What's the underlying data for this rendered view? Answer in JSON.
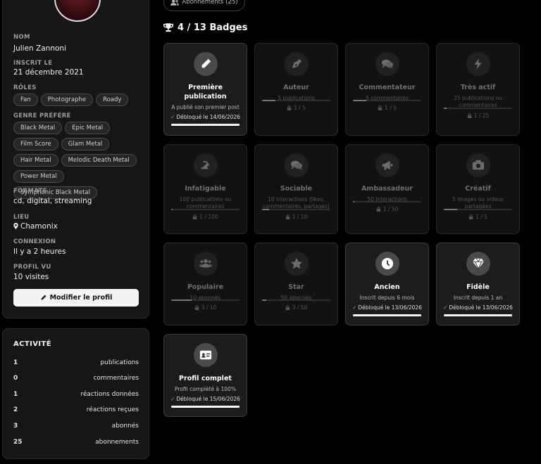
{
  "profile": {
    "name_label": "NOM",
    "name": "Julien Zannoni",
    "joined_label": "INSCRIT LE",
    "joined": "21 décembre 2021",
    "roles_label": "RÔLES",
    "roles": [
      "Fan",
      "Photographe",
      "Roady"
    ],
    "genres_label": "GENRE PRÉFÉRÉ",
    "genres": [
      "Black Metal",
      "Epic Metal",
      "Film Score",
      "Glam Metal",
      "Hair Metal",
      "Melodic Death Metal",
      "Power Metal",
      "Symphonic Black Metal"
    ],
    "formats_label": "FORMATS",
    "formats": "cd, digital, streaming",
    "location_label": "LIEU",
    "location": "Chamonix",
    "connection_label": "CONNEXION",
    "connection": "Il y a 2 heures",
    "views_label": "PROFIL VU",
    "views": "10 visites",
    "edit_button": "Modifier le profil"
  },
  "activity": {
    "title": "ACTIVITÉ",
    "rows": [
      {
        "count": "1",
        "label": "publications"
      },
      {
        "count": "0",
        "label": "commentaires"
      },
      {
        "count": "1",
        "label": "réactions données"
      },
      {
        "count": "2",
        "label": "réactions reçues"
      },
      {
        "count": "3",
        "label": "abonnés"
      },
      {
        "count": "25",
        "label": "abonnements"
      }
    ]
  },
  "subscriptions_pill": "Abonnements (25)",
  "badges_title": "4 / 13 Badges",
  "badges": [
    {
      "name": "Première publication",
      "icon": "pencil-icon",
      "desc": "A publié son premier post",
      "unlocked": true,
      "unlock_text": "Débloqué le 14/06/2026",
      "progress": "",
      "fraction": 1
    },
    {
      "name": "Auteur",
      "icon": "pen-nib-icon",
      "desc": "5 publications",
      "unlocked": false,
      "progress": "1 / 5",
      "fraction": 0.2
    },
    {
      "name": "Commentateur",
      "icon": "comments-icon",
      "desc": "5 commentaires",
      "unlocked": false,
      "progress": "1 / 5",
      "fraction": 0.2
    },
    {
      "name": "Très actif",
      "icon": "bolt-icon",
      "desc": "25 publications ou commentaires",
      "unlocked": false,
      "progress": "1 / 25",
      "fraction": 0.04
    },
    {
      "name": "Infatigable",
      "icon": "running-icon",
      "desc": "100 publications ou commentaires",
      "unlocked": false,
      "progress": "1 / 100",
      "fraction": 0.01
    },
    {
      "name": "Sociable",
      "icon": "comments-icon",
      "desc": "10 interactions (likes, commentaires, partages)",
      "unlocked": false,
      "progress": "1 / 10",
      "fraction": 0.1
    },
    {
      "name": "Ambassadeur",
      "icon": "megaphone-icon",
      "desc": "50 interactions",
      "unlocked": false,
      "progress": "1 / 50",
      "fraction": 0.02
    },
    {
      "name": "Créatif",
      "icon": "camera-icon",
      "desc": "5 images ou vidéos partagées",
      "unlocked": false,
      "progress": "1 / 5",
      "fraction": 0.2
    },
    {
      "name": "Populaire",
      "icon": "users-icon",
      "desc": "10 abonnés",
      "unlocked": false,
      "progress": "3 / 10",
      "fraction": 0.3
    },
    {
      "name": "Star",
      "icon": "star-icon",
      "desc": "50 abonnés",
      "unlocked": false,
      "progress": "3 / 50",
      "fraction": 0.06
    },
    {
      "name": "Ancien",
      "icon": "clock-icon",
      "desc": "Inscrit depuis 6 mois",
      "unlocked": true,
      "unlock_text": "Débloqué le 13/06/2026",
      "progress": "",
      "fraction": 1
    },
    {
      "name": "Fidèle",
      "icon": "gem-icon",
      "desc": "Inscrit depuis 1 an",
      "unlocked": true,
      "unlock_text": "Débloqué le 13/06/2026",
      "progress": "",
      "fraction": 1
    },
    {
      "name": "Profil complet",
      "icon": "id-card-icon",
      "desc": "Profil complété à 100%",
      "unlocked": true,
      "unlock_text": "Débloqué le 15/06/2026",
      "progress": "",
      "fraction": 1
    }
  ]
}
